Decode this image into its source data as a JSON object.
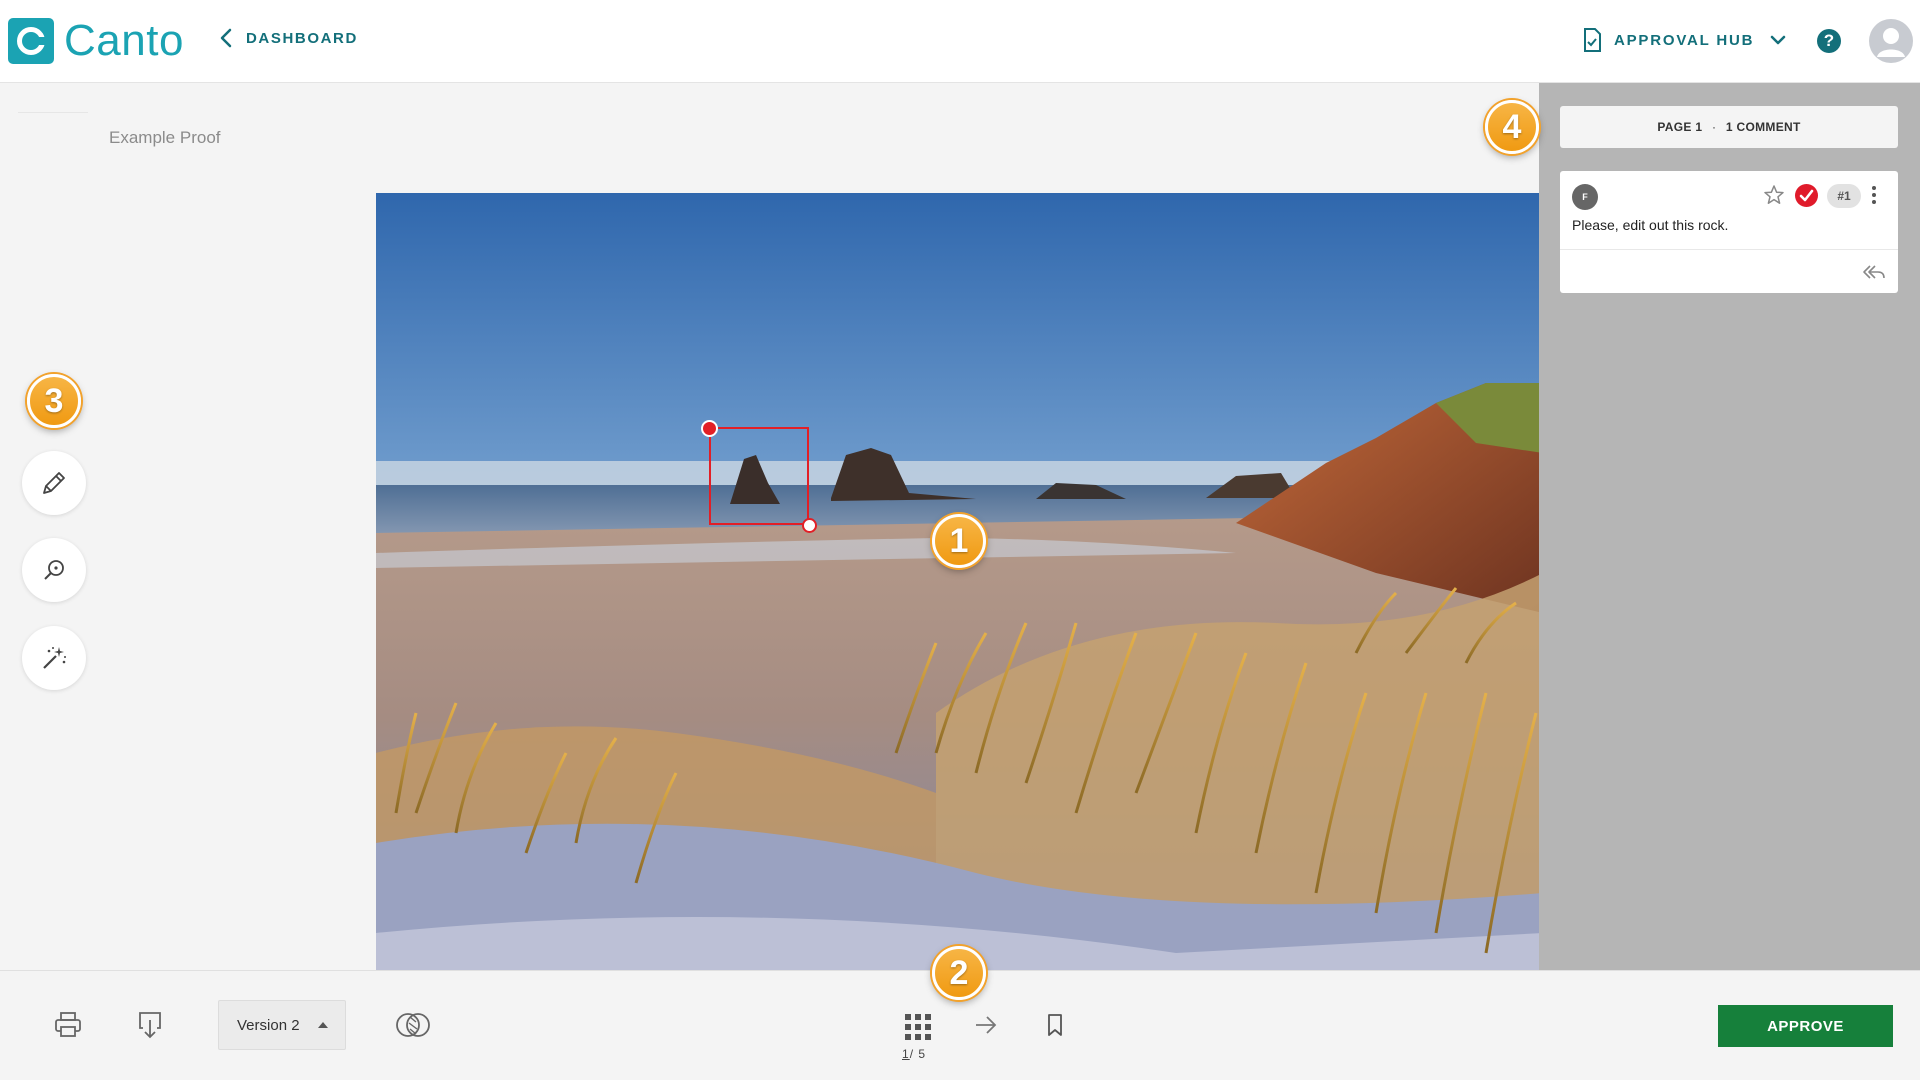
{
  "header": {
    "logo_text": "Canto",
    "back_label": "DASHBOARD",
    "approval_hub_label": "APPROVAL HUB",
    "help_label": "?"
  },
  "proof": {
    "title": "Example Proof"
  },
  "tools": [
    {
      "name": "pencil-icon"
    },
    {
      "name": "zoom-icon"
    },
    {
      "name": "magic-wand-icon"
    }
  ],
  "badges": {
    "b1": "1",
    "b2": "2",
    "b3": "3",
    "b4": "4"
  },
  "comments_panel": {
    "page_label": "PAGE 1",
    "separator": "·",
    "count_label": "1 COMMENT",
    "comment": {
      "author_initial": "F",
      "number": "#1",
      "text": "Please, edit out this rock."
    }
  },
  "footer": {
    "version_label": "Version 2",
    "page_current": "1",
    "page_total": "/ 5",
    "approve_label": "APPROVE"
  },
  "colors": {
    "brand": "#1ba3b3",
    "link": "#136f7a",
    "approve": "#16803b",
    "annotation": "#e21f26",
    "badge": "#f2a22c"
  }
}
